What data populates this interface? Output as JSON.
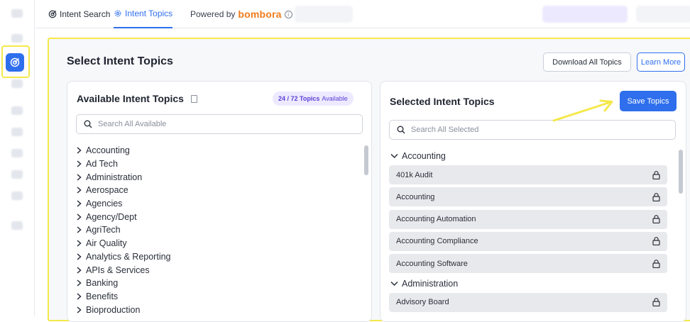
{
  "topbar": {
    "tabs": [
      {
        "label": "Intent Search"
      },
      {
        "label": "Intent Topics"
      }
    ],
    "powered_by": "Powered by",
    "brand": "bombora",
    "info_glyph": "i"
  },
  "page": {
    "title": "Select Intent Topics",
    "download_label": "Download All Topics",
    "learn_label": "Learn More"
  },
  "available": {
    "title": "Available Intent Topics",
    "badge_count": "24 / 72 Topics",
    "badge_suffix": "Available",
    "search_placeholder": "Search All Available",
    "topics": [
      "Accounting",
      "Ad Tech",
      "Administration",
      "Aerospace",
      "Agencies",
      "Agency/Dept",
      "AgriTech",
      "Air Quality",
      "Analytics & Reporting",
      "APIs & Services",
      "Banking",
      "Benefits",
      "Bioproduction"
    ]
  },
  "selected": {
    "title": "Selected Intent Topics",
    "save_label": "Save Topics",
    "search_placeholder": "Search All Selected",
    "groups": [
      {
        "name": "Accounting",
        "items": [
          "401k Audit",
          "Accounting",
          "Accounting Automation",
          "Accounting Compliance",
          "Accounting Software"
        ]
      },
      {
        "name": "Administration",
        "items": [
          "Advisory Board"
        ]
      }
    ]
  },
  "colors": {
    "accent": "#2f6fed",
    "brand": "#f07c1e",
    "highlight": "#f4e84a"
  }
}
